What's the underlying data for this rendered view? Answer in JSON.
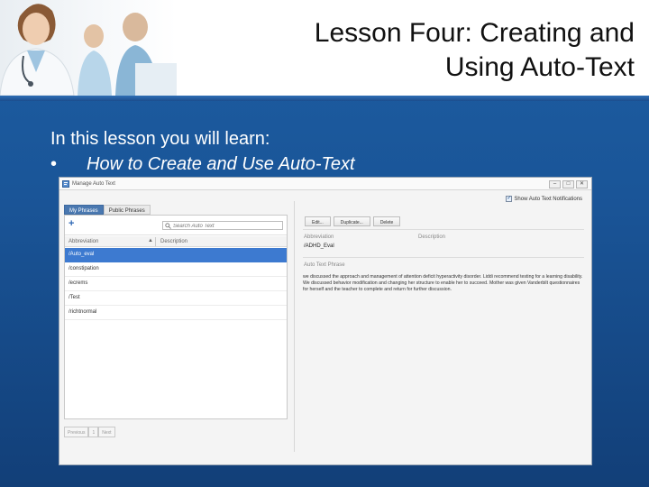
{
  "slide": {
    "title_line1": "Lesson Four: Creating and",
    "title_line2": "Using Auto-Text",
    "intro": "In this lesson you will learn:",
    "bullet_mark": "•",
    "bullet": "How to Create and Use Auto-Text"
  },
  "window": {
    "title": "Manage Auto Text",
    "minimize_label": "–",
    "maximize_label": "□",
    "close_label": "✕",
    "show_notifications_label": "Show Auto Text Notifications",
    "show_notifications_checked": true
  },
  "left": {
    "tabs": [
      "My Phrases",
      "Public Phrases"
    ],
    "active_tab": 0,
    "search_placeholder": "Search Auto Text",
    "col_abbr": "Abbreviation",
    "col_desc": "Description",
    "sort_arrow": "▲",
    "rows": [
      "/Auto_eval",
      "/constipation",
      "/ecrems",
      "/Test",
      "/richtnormal"
    ],
    "selected_row": 0,
    "pager": {
      "previous": "Previous",
      "page": "1",
      "next": "Next"
    }
  },
  "right": {
    "edit_label": "Edit...",
    "duplicate_label": "Duplicate...",
    "delete_label": "Delete",
    "abbr_label": "Abbreviation",
    "abbr_value": "/ADHD_Eval",
    "desc_label": "Description",
    "phrase_label": "Auto Text Phrase",
    "phrase_text": "we discussed the approach and management of attention deficit hyperactivity disorder. Liddi recommend testing for a learning disability. We discussed behavior modification and changing her structure to enable her to succeed. Mother was given Vanderbilt questionnaires for herself and the teacher to complete and return for further discussion."
  },
  "colors": {
    "slide_blue": "#1d5ea3",
    "selection_blue": "#3d7ad0",
    "active_tab": "#4a78b0"
  }
}
